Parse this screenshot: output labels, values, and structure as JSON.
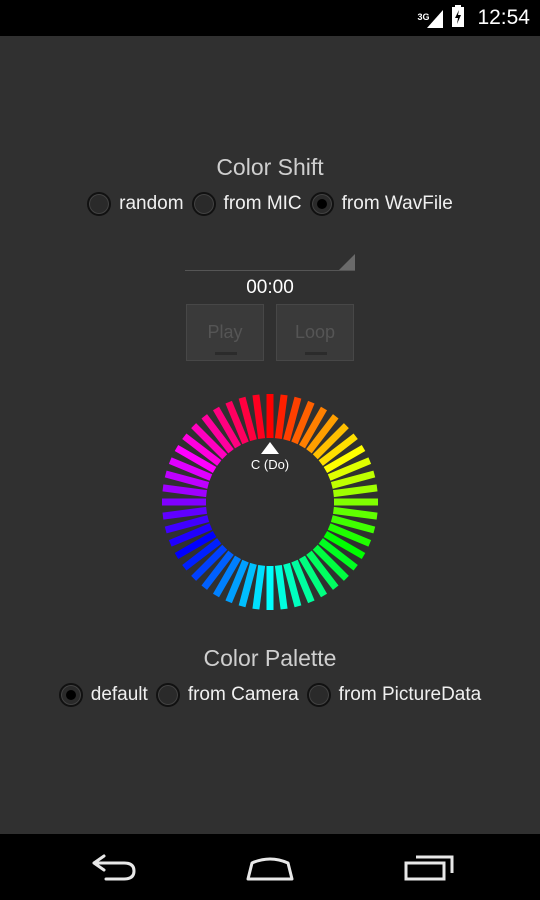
{
  "status_bar": {
    "network": "3G",
    "time": "12:54"
  },
  "color_shift": {
    "title": "Color Shift",
    "options": [
      {
        "label": "random",
        "checked": false
      },
      {
        "label": "from MIC",
        "checked": false
      },
      {
        "label": "from WavFile",
        "checked": true
      }
    ]
  },
  "player": {
    "time": "00:00",
    "play_label": "Play",
    "loop_label": "Loop"
  },
  "wheel": {
    "note_label": "C (Do)",
    "segments": 48
  },
  "color_palette": {
    "title": "Color Palette",
    "options": [
      {
        "label": "default",
        "checked": true
      },
      {
        "label": "from Camera",
        "checked": false
      },
      {
        "label": "from PictureData",
        "checked": false
      }
    ]
  },
  "icons": {
    "back": "back-arrow-icon",
    "home": "home-icon",
    "recents": "recent-apps-icon"
  }
}
